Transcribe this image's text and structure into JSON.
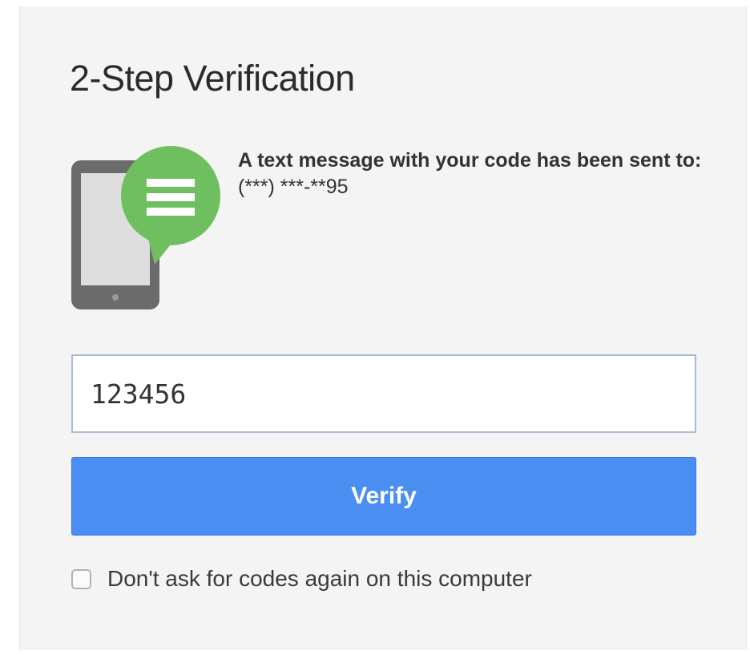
{
  "page": {
    "title": "2-Step Verification"
  },
  "sms_notice": {
    "icon": "phone-message-icon",
    "message": "A text message with your code has been sent to:",
    "masked_phone": "(***) ***-**95"
  },
  "code_field": {
    "value": "123456"
  },
  "verify_button": {
    "label": "Verify"
  },
  "remember_device": {
    "label": "Don't ask for codes again on this computer",
    "checked": false
  },
  "colors": {
    "card_background": "#f4f4f4",
    "button_blue": "#4b8ef1",
    "bubble_green": "#6fbe5f",
    "phone_gray": "#6b6b6b",
    "input_border": "#a9bcd6"
  }
}
